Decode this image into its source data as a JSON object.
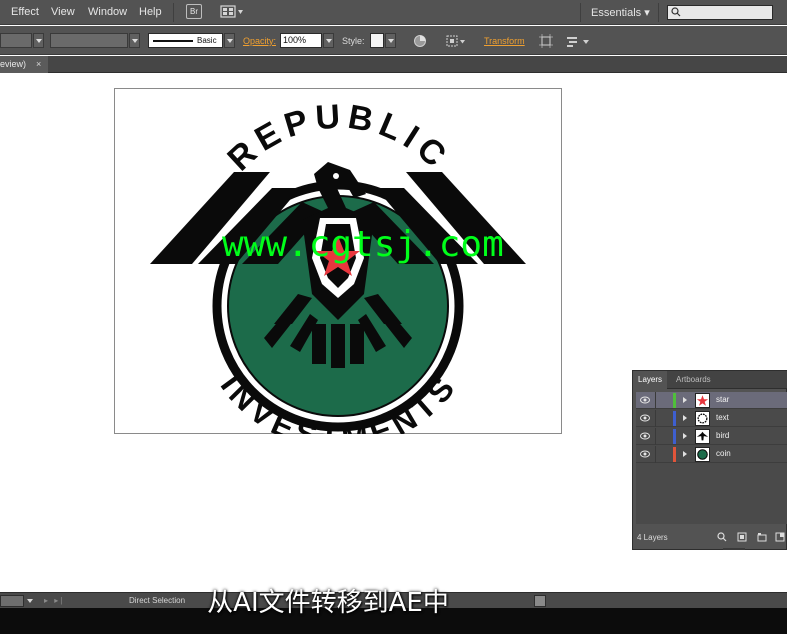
{
  "menubar": {
    "items": [
      "Effect",
      "View",
      "Window",
      "Help"
    ],
    "bridge_label": "Br",
    "workspace": "Essentials",
    "search_placeholder": ""
  },
  "controlbar": {
    "stroke_style": "Basic",
    "opacity_label": "Opacity:",
    "opacity_value": "100%",
    "style_label": "Style:",
    "transform_label": "Transform"
  },
  "tabbar": {
    "document_tab": "eview)",
    "close_glyph": "×"
  },
  "artwork": {
    "top_text": "REPUBLIC",
    "bottom_text": "INVESTMENTS",
    "colors": {
      "green": "#1c6b4a",
      "black": "#0a0a0a",
      "star": "#e8373e"
    }
  },
  "watermark": "www.cgtsj.com",
  "layers_panel": {
    "tabs": [
      "Layers",
      "Artboards"
    ],
    "layers": [
      {
        "name": "star",
        "color": "#4fbf3a",
        "selected": true
      },
      {
        "name": "text",
        "color": "#3e5fcf",
        "selected": false
      },
      {
        "name": "bird",
        "color": "#3e5fcf",
        "selected": false
      },
      {
        "name": "coin",
        "color": "#e0553a",
        "selected": false
      }
    ],
    "count_label": "4 Layers"
  },
  "statusbar": {
    "tool_name": "Direct Selection"
  },
  "subtitle": "从AI文件转移到AE中"
}
